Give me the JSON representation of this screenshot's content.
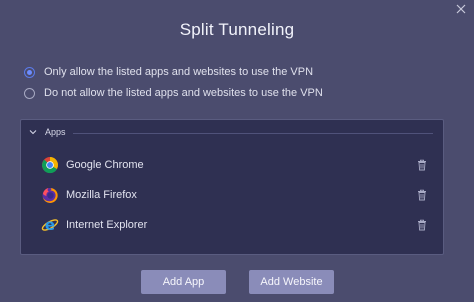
{
  "window": {
    "title": "Split Tunneling"
  },
  "mode_options": [
    {
      "label": "Only allow the listed apps and websites to use the VPN",
      "selected": true
    },
    {
      "label": "Do not allow the listed apps and websites to use the VPN",
      "selected": false
    }
  ],
  "apps_panel": {
    "header": "Apps",
    "items": [
      {
        "name": "Google Chrome",
        "icon": "chrome-icon"
      },
      {
        "name": "Mozilla Firefox",
        "icon": "firefox-icon"
      },
      {
        "name": "Internet Explorer",
        "icon": "internet-explorer-icon"
      }
    ]
  },
  "actions": {
    "add_app": "Add App",
    "add_website": "Add Website"
  },
  "colors": {
    "background": "#4b4c6e",
    "panel": "#2f3052",
    "button": "#8a8cb9",
    "radio_accent": "#6c8cff"
  }
}
